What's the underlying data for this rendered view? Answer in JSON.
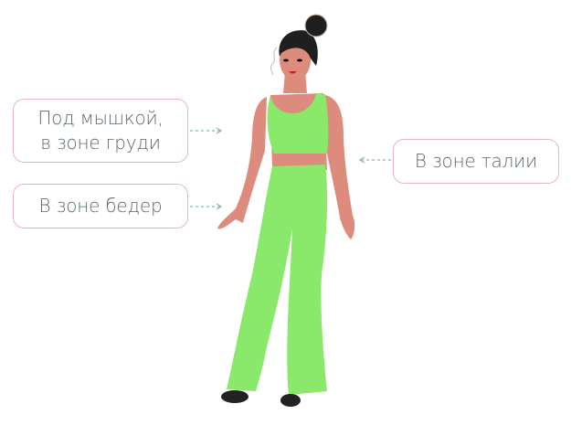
{
  "labels": {
    "underarm_line1": "Под мышкой,",
    "underarm_line2": "в зоне груди",
    "hips": "В зоне бедер",
    "waist": "В зоне талии"
  },
  "colors": {
    "border": "#eab3c6",
    "text": "#5b6870",
    "arrow": "#8fb4b8",
    "skin": "#dd8b7c",
    "clothes": "#8ae86a",
    "hair": "#1f1f1f"
  }
}
